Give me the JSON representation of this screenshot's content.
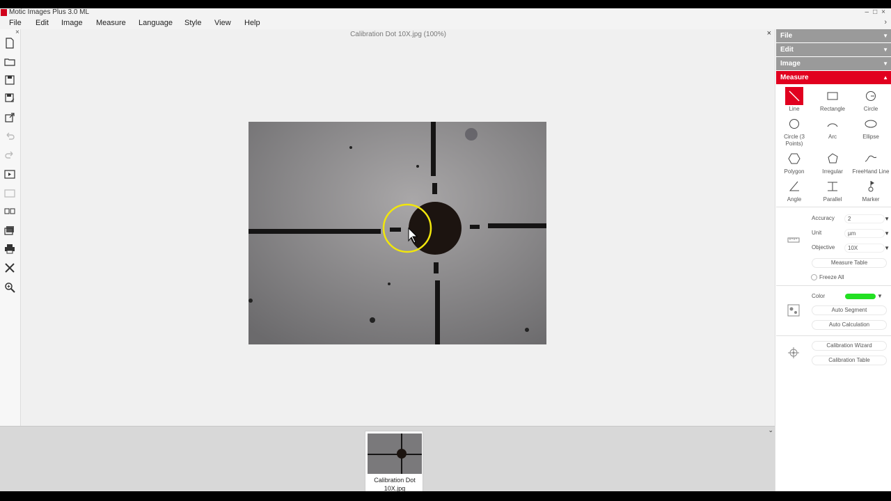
{
  "app": {
    "title": "Motic Images Plus 3.0 ML",
    "logo_color": "#d0021b"
  },
  "window_controls": {
    "minimize": "–",
    "maximize": "□",
    "close": "×"
  },
  "menu": {
    "items": [
      "File",
      "Edit",
      "Image",
      "Measure",
      "Language",
      "Style",
      "View",
      "Help"
    ],
    "overflow": "›"
  },
  "document": {
    "title": "Calibration Dot 10X.jpg (100%)",
    "close": "×"
  },
  "left_toolbar": {
    "close": "×",
    "icons": [
      "new-file-icon",
      "open-folder-icon",
      "save-icon",
      "save-as-icon",
      "export-icon",
      "undo-icon",
      "redo-icon",
      "slideshow-icon",
      "capture-icon",
      "compare-icon",
      "gallery-icon",
      "print-icon",
      "tools-icon",
      "zoom-icon"
    ]
  },
  "thumbnails": [
    {
      "caption": "Calibration Dot 10X.jpg"
    }
  ],
  "thumbbar": {
    "toggle": "⌄"
  },
  "right_panel": {
    "sections": [
      {
        "label": "File",
        "expanded": false
      },
      {
        "label": "Edit",
        "expanded": false
      },
      {
        "label": "Image",
        "expanded": false
      },
      {
        "label": "Measure",
        "expanded": true
      }
    ],
    "tools": [
      {
        "label": "Line",
        "icon": "line-icon",
        "active": true
      },
      {
        "label": "Rectangle",
        "icon": "rectangle-icon"
      },
      {
        "label": "Circle",
        "icon": "circle-icon"
      },
      {
        "label": "Circle (3 Points)",
        "icon": "circle-3-points-icon"
      },
      {
        "label": "Arc",
        "icon": "arc-icon"
      },
      {
        "label": "Ellipse",
        "icon": "ellipse-icon"
      },
      {
        "label": "Polygon",
        "icon": "polygon-icon"
      },
      {
        "label": "Irregular",
        "icon": "irregular-icon"
      },
      {
        "label": "FreeHand Line",
        "icon": "freehand-line-icon"
      },
      {
        "label": "Angle",
        "icon": "angle-icon"
      },
      {
        "label": "Parallel",
        "icon": "parallel-icon"
      },
      {
        "label": "Marker",
        "icon": "marker-icon"
      }
    ],
    "settings": {
      "accuracy_label": "Accuracy",
      "accuracy_value": "2",
      "unit_label": "Unit",
      "unit_value": "µm",
      "objective_label": "Objective",
      "objective_value": "10X",
      "measure_table": "Measure Table",
      "freeze_all": "Freeze All",
      "color_label": "Color",
      "color_value": "#22e022",
      "auto_segment": "Auto Segment",
      "auto_calculation": "Auto Calculation",
      "calibration_wizard": "Calibration Wizard",
      "calibration_table": "Calibration Table"
    }
  },
  "colors": {
    "accent": "#e1001f",
    "section_header": "#9a9a9a",
    "cursor_highlight": "#f1e60c"
  }
}
